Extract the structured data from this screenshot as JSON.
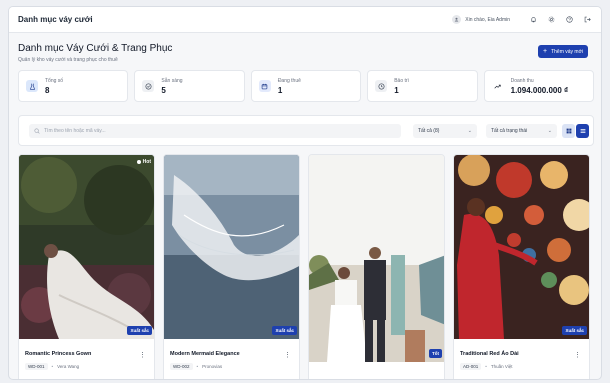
{
  "header": {
    "app_title": "Danh mục váy cưới",
    "greeting": "Xin chào, Eia Admin",
    "icons": [
      "bell-icon",
      "gear-icon",
      "help-icon",
      "logout-icon"
    ]
  },
  "page": {
    "title": "Danh mục Váy Cưới & Trang Phục",
    "subtitle": "Quản lý kho váy cưới và trang phục cho thuê",
    "add_button": "Thêm váy mới"
  },
  "stats": [
    {
      "label": "Tổng số",
      "value": "8",
      "icon": "dress-icon"
    },
    {
      "label": "Sẵn sàng",
      "value": "5",
      "icon": "check-circle-icon"
    },
    {
      "label": "Đang thuê",
      "value": "1",
      "icon": "calendar-icon"
    },
    {
      "label": "Bảo trì",
      "value": "1",
      "icon": "clock-icon"
    },
    {
      "label": "Doanh thu",
      "value": "1.094.000.000 ₫",
      "icon": "trend-icon"
    }
  ],
  "filters": {
    "search_placeholder": "Tìm theo tên hoặc mã váy...",
    "category_select": "Tất cả (8)",
    "status_select": "Tất cả trạng thái"
  },
  "cards": [
    {
      "name": "Romantic Princess Gown",
      "code": "WD-001",
      "brand": "Vera Wang",
      "badge": "Xuất sắc",
      "hot": "Hot"
    },
    {
      "name": "Modern Mermaid Elegance",
      "code": "WD-002",
      "brand": "Pronovias",
      "badge": "Xuất sắc"
    },
    {
      "name": "",
      "code": "",
      "brand": "",
      "badge": "Tốt"
    },
    {
      "name": "Traditional Red Áo Dài",
      "code": "AD-001",
      "brand": "Thuần Việt",
      "badge": "Xuất sắc"
    }
  ],
  "colors": {
    "accent": "#1e40af",
    "stat_bg_1": "#dbe7fb",
    "stat_bg_2": "#eef0f3",
    "stat_bg_3": "#e3eafc",
    "stat_bg_4": "#eef0f3",
    "stat_bg_5": "#ffffff"
  }
}
